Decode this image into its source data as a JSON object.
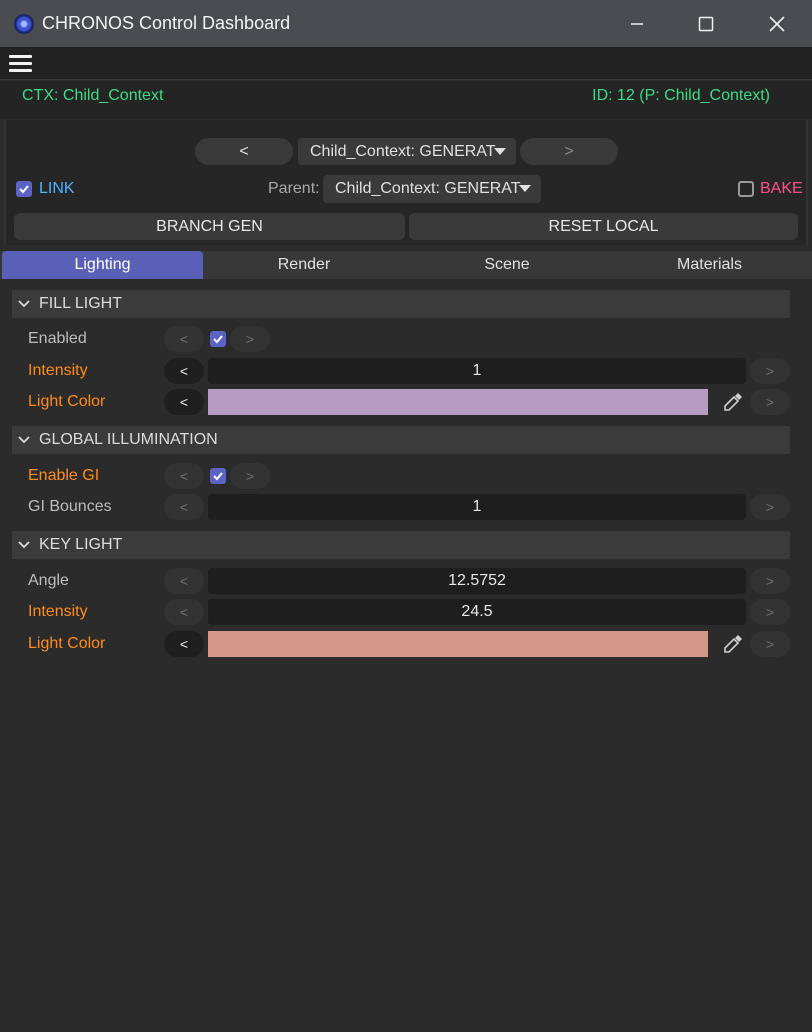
{
  "window": {
    "title": "CHRONOS Control Dashboard"
  },
  "context": {
    "ctx": "CTX: Child_Context",
    "id": "ID: 12 (P: Child_Context)"
  },
  "nav": {
    "prev": "<",
    "next": ">",
    "current": "Child_Context: GENERAT",
    "parent_label": "Parent:",
    "parent_value": "Child_Context: GENERAT",
    "link_label": "LINK",
    "link_checked": true,
    "bake_label": "BAKE",
    "bake_checked": false,
    "branch_gen": "BRANCH GEN",
    "reset_local": "RESET LOCAL"
  },
  "tabs": [
    {
      "label": "Lighting",
      "active": true
    },
    {
      "label": "Render",
      "active": false
    },
    {
      "label": "Scene",
      "active": false
    },
    {
      "label": "Materials",
      "active": false
    }
  ],
  "sections": {
    "fill_light": {
      "title": "FILL LIGHT",
      "enabled": {
        "label": "Enabled",
        "checked": true
      },
      "intensity": {
        "label": "Intensity",
        "value": "1"
      },
      "color": {
        "label": "Light Color",
        "hex": "#b99cc3"
      }
    },
    "gi": {
      "title": "GLOBAL ILLUMINATION",
      "enable": {
        "label": "Enable GI",
        "checked": true
      },
      "bounces": {
        "label": "GI Bounces",
        "value": "1"
      }
    },
    "key_light": {
      "title": "KEY LIGHT",
      "angle": {
        "label": "Angle",
        "value": "12.5752"
      },
      "intensity": {
        "label": "Intensity",
        "value": "24.5"
      },
      "color": {
        "label": "Light Color",
        "hex": "#d4998a"
      }
    }
  },
  "step": {
    "left": "<",
    "right": ">"
  },
  "colors": {
    "accent": "#5a60b8",
    "modified": "#ff8c1a",
    "status": "#3ddc84",
    "link": "#4fb3ff",
    "bake": "#ff4f8a"
  },
  "icons": [
    "app-logo-icon",
    "minimize-icon",
    "maximize-icon",
    "close-icon",
    "hamburger-menu-icon",
    "chevron-down-icon",
    "eyedropper-icon",
    "check-icon"
  ]
}
